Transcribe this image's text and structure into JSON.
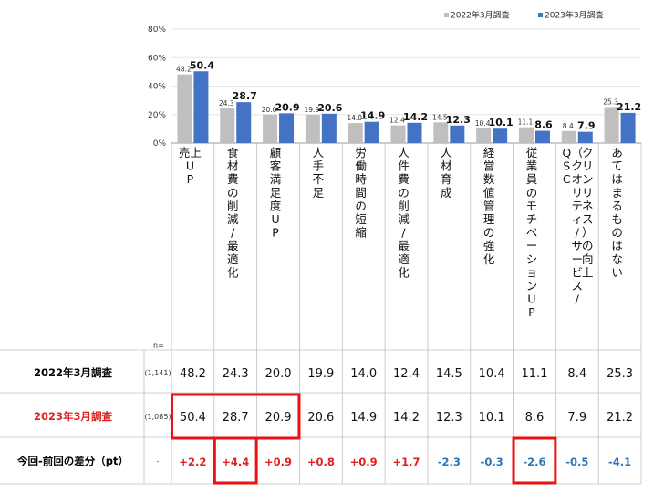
{
  "chart_data": {
    "type": "bar",
    "ylim": [
      0,
      80
    ],
    "yticks": [
      "0%",
      "20%",
      "40%",
      "60%",
      "80%"
    ],
    "categories": [
      "売上UP",
      "食材費の削減/最適化",
      "顧客満足度UP",
      "人手不足",
      "労働時間の短縮",
      "人件費の削減/最適化",
      "人材育成",
      "経営数値管理の強化",
      "従業員のモチベーションUP",
      "QSC（クオリティ/サービス/クリンリネス）の向上",
      "あてはまるものはない"
    ],
    "category_display": [
      [
        "売上",
        "U",
        "P"
      ],
      [
        "食",
        "材",
        "費",
        "の",
        "削",
        "減",
        "/",
        "最",
        "適",
        "化"
      ],
      [
        "顧",
        "客",
        "満",
        "足",
        "度",
        "U",
        "P"
      ],
      [
        "人",
        "手",
        "不",
        "足"
      ],
      [
        "労",
        "働",
        "時",
        "間",
        "の",
        "短",
        "縮"
      ],
      [
        "人",
        "件",
        "費",
        "の",
        "削",
        "減",
        "/",
        "最",
        "適",
        "化"
      ],
      [
        "人",
        "材",
        "育",
        "成"
      ],
      [
        "経",
        "営",
        "数",
        "値",
        "管",
        "理",
        "の",
        "強",
        "化"
      ],
      [
        "従",
        "業",
        "員",
        "の",
        "モ",
        "チ",
        "ベ",
        "ー",
        "シ",
        "ョ",
        "ン",
        "U",
        "P"
      ],
      [
        [
          "Q",
          "S",
          "C"
        ],
        [
          "（",
          "ク",
          "オ",
          "リ",
          "テ",
          "ィ",
          "/",
          "サ",
          "ー",
          "ビ",
          "ス",
          "/"
        ],
        [
          "ク",
          "リ",
          "ン",
          "リ",
          "ネ",
          "ス",
          "）",
          "の",
          "向",
          "上"
        ]
      ],
      [
        "あ",
        "て",
        "は",
        "ま",
        "る",
        "も",
        "の",
        "は",
        "な",
        "い"
      ]
    ],
    "series": [
      {
        "name": "2022年3月調査",
        "color": "#bfbfbf",
        "values": [
          48.2,
          24.3,
          20.0,
          19.9,
          14.0,
          12.4,
          14.5,
          10.4,
          11.1,
          8.4,
          25.3
        ]
      },
      {
        "name": "2023年3月調査",
        "color": "#4472c4",
        "values": [
          50.4,
          28.7,
          20.9,
          20.6,
          14.9,
          14.2,
          12.3,
          10.1,
          8.6,
          7.9,
          21.2
        ]
      }
    ],
    "legend_position": "top-right"
  },
  "table": {
    "n_label": "n=",
    "rows": [
      {
        "label": "2022年3月調査",
        "label_color": "#000000",
        "n": "(1,141)",
        "values": [
          "48.2",
          "24.3",
          "20.0",
          "19.9",
          "14.0",
          "12.4",
          "14.5",
          "10.4",
          "11.1",
          "8.4",
          "25.3"
        ]
      },
      {
        "label": "2023年3月調査",
        "label_color": "#e02020",
        "n": "(1,085)",
        "values": [
          "50.4",
          "28.7",
          "20.9",
          "20.6",
          "14.9",
          "14.2",
          "12.3",
          "10.1",
          "8.6",
          "7.9",
          "21.2"
        ]
      },
      {
        "label": "今回-前回の差分（pt）",
        "label_color": "#000000",
        "n": "-",
        "values": [
          "+2.2",
          "+4.4",
          "+0.9",
          "+0.8",
          "+0.9",
          "+1.7",
          "-2.3",
          "-0.3",
          "-2.6",
          "-0.5",
          "-4.1"
        ]
      }
    ],
    "positive_color": "#e02020",
    "negative_color": "#2e75b6",
    "highlight_color": "#ee1111"
  }
}
